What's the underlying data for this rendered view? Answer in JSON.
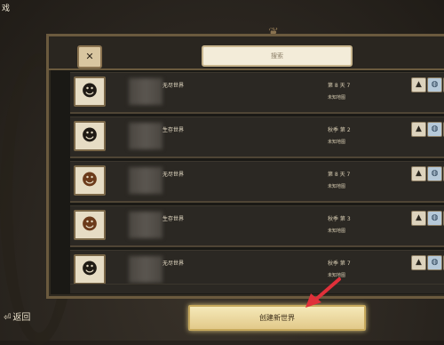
{
  "window_title_partial": "戏",
  "filter_icon_glyph": "✕",
  "search_placeholder": "搜索",
  "ornament_glyph": "❦",
  "rows": [
    {
      "avatar": "wilson",
      "mode": "无尽世界",
      "info1": "第 8 天 7",
      "info2": "未知地图"
    },
    {
      "avatar": "wilson",
      "mode": "生存世界",
      "info1": "秋季 第 2",
      "info2": "未知地图"
    },
    {
      "avatar": "wolfgang",
      "mode": "无尽世界",
      "info1": "第 8 天 7",
      "info2": "未知地图"
    },
    {
      "avatar": "wolfgang",
      "mode": "生存世界",
      "info1": "秋季 第 3",
      "info2": "未知地图"
    },
    {
      "avatar": "wilson",
      "mode": "无尽世界",
      "info1": "秋季 第 7",
      "info2": "未知地图"
    }
  ],
  "back_label": "返回",
  "create_button_label": "创建新世界",
  "colors": {
    "highlight_arrow": "#e0303a",
    "accent_gold": "#e2c98a"
  }
}
